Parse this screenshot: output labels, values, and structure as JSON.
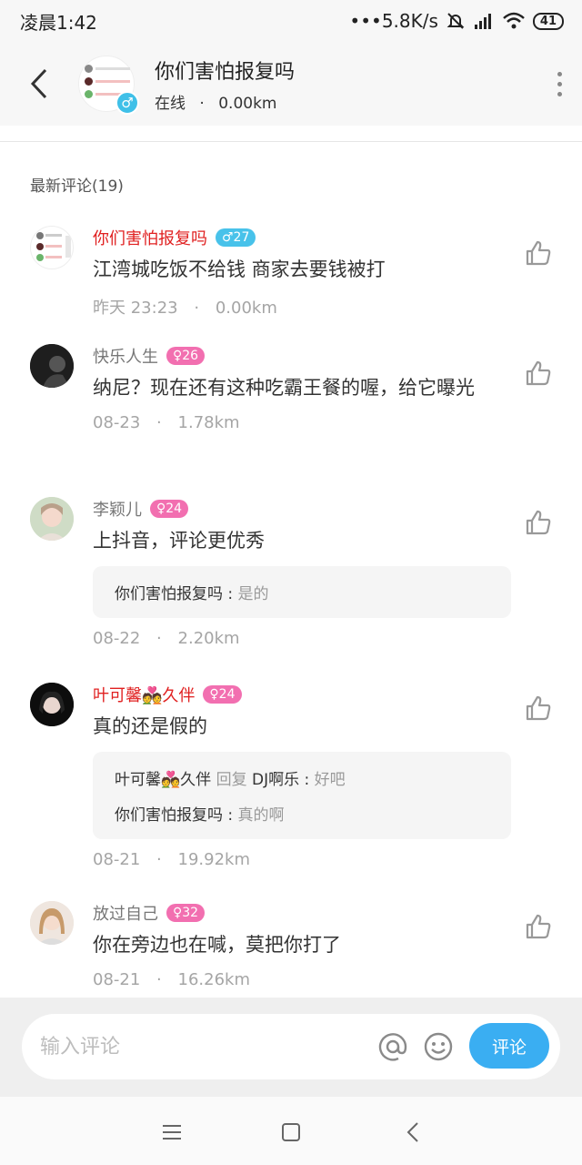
{
  "status": {
    "time": "凌晨1:42",
    "network": "•••5.8K/s",
    "battery": "41"
  },
  "header": {
    "title": "你们害怕报复吗",
    "status": "在线",
    "distance": "0.00km",
    "gender_symbol": "♂"
  },
  "section_title": "最新评论(19)",
  "comments": [
    {
      "name": "你们害怕报复吗",
      "badge": "♂27",
      "text": "江湾城吃饭不给钱 商家去要钱被打",
      "time": "昨天 23:23",
      "distance": "0.00km"
    },
    {
      "name": "快乐人生",
      "badge": "♀26",
      "text": "纳尼？现在还有这种吃霸王餐的喔，给它曝光",
      "time": "08-23",
      "distance": "1.78km"
    },
    {
      "name": "李颖儿",
      "badge": "♀24",
      "text": "上抖音，评论更优秀",
      "time": "08-22",
      "distance": "2.20km",
      "reply": {
        "name": "你们害怕报复吗 : ",
        "text": "是的"
      }
    },
    {
      "name": "叶可馨💑久伴",
      "badge": "♀24",
      "text": "真的还是假的",
      "time": "08-21",
      "distance": "19.92km",
      "replies": [
        {
          "name": "叶可馨💑久伴",
          "mid": " 回复 ",
          "target": "DJ啊乐 : ",
          "text": "好吧"
        },
        {
          "name": "你们害怕报复吗 : ",
          "text": "真的啊"
        }
      ]
    },
    {
      "name": "放过自己",
      "badge": "♀32",
      "text": "你在旁边也在喊，莫把你打了",
      "time": "08-21",
      "distance": "16.26km"
    }
  ],
  "meta_separator": "·",
  "input": {
    "placeholder": "输入评论",
    "send_label": "评论"
  },
  "colors": {
    "accent": "#3aaef2",
    "male_badge": "#48c2ea",
    "female_badge": "#f26fb0",
    "name_red": "#e02020"
  }
}
